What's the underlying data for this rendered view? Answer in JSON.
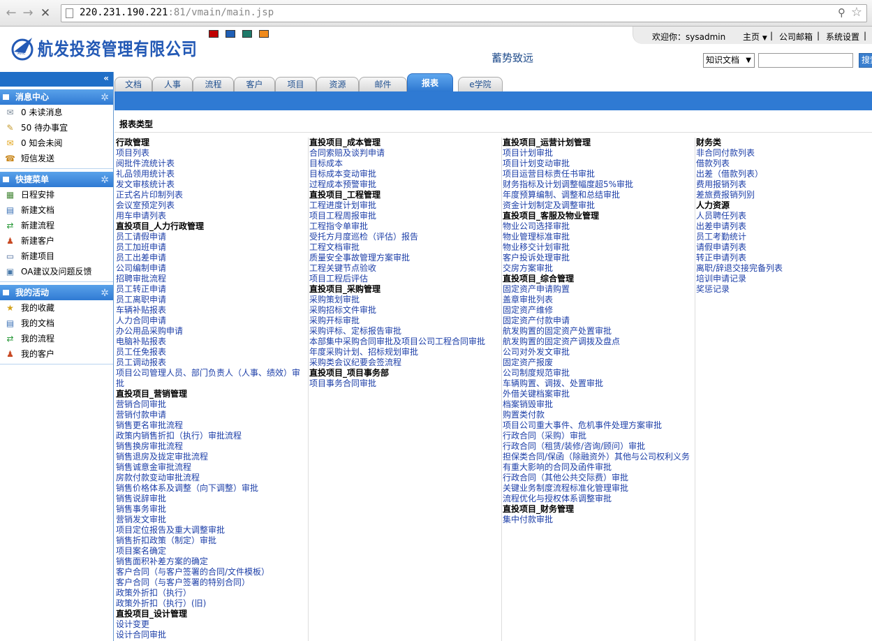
{
  "browser": {
    "url_host": "220.231.190.221",
    "url_rest": ":81/vmain/main.jsp"
  },
  "header": {
    "company_name": "航发投资管理有限公司",
    "slogan": "蓄势致远",
    "welcome": "欢迎你：sysadmin",
    "home": "主页",
    "mail": "公司邮箱",
    "settings": "系统设置",
    "search_select": "知识文档",
    "search_button": "搜索",
    "swatch_colors": [
      "#c00000",
      "#1f5fb5",
      "#1f7a6a",
      "#f08a1c"
    ]
  },
  "sidebar": {
    "collapse": "«",
    "panels": [
      {
        "title": "消息中心",
        "items": [
          "0 未读消息",
          "50 待办事宜",
          "0 知会未阅",
          "短信发送"
        ]
      },
      {
        "title": "快捷菜单",
        "items": [
          "日程安排",
          "新建文档",
          "新建流程",
          "新建客户",
          "新建项目",
          "OA建议及问题反馈"
        ]
      },
      {
        "title": "我的活动",
        "items": [
          "我的收藏",
          "我的文档",
          "我的流程",
          "我的客户"
        ]
      }
    ]
  },
  "tabs": [
    "文档",
    "人事",
    "流程",
    "客户",
    "项目",
    "资源",
    "邮件",
    "报表",
    "e学院"
  ],
  "active_tab": "报表",
  "section_title": "报表类型",
  "columns": [
    [
      {
        "t": "h",
        "v": "行政管理"
      },
      {
        "t": "l",
        "v": "项目列表"
      },
      {
        "t": "l",
        "v": "阅批件流统计表"
      },
      {
        "t": "l",
        "v": "礼品领用统计表"
      },
      {
        "t": "l",
        "v": "发文审核统计表"
      },
      {
        "t": "l",
        "v": "正式名片印制列表"
      },
      {
        "t": "l",
        "v": "会议室预定列表"
      },
      {
        "t": "l",
        "v": "用车申请列表"
      },
      {
        "t": "h",
        "v": "直投项目_人力行政管理"
      },
      {
        "t": "l",
        "v": "员工请假申请"
      },
      {
        "t": "l",
        "v": "员工加班申请"
      },
      {
        "t": "l",
        "v": "员工出差申请"
      },
      {
        "t": "l",
        "v": "公司编制申请"
      },
      {
        "t": "l",
        "v": "招聘审批流程"
      },
      {
        "t": "l",
        "v": "员工转正申请"
      },
      {
        "t": "l",
        "v": "员工离职申请"
      },
      {
        "t": "l",
        "v": "车辆补贴报表"
      },
      {
        "t": "l",
        "v": "人力合同申请"
      },
      {
        "t": "l",
        "v": "办公用品采购申请"
      },
      {
        "t": "l",
        "v": "电脑补贴报表"
      },
      {
        "t": "l",
        "v": "员工任免报表"
      },
      {
        "t": "l",
        "v": "员工调动报表"
      },
      {
        "t": "w",
        "v": "项目公司管理人员、部门负责人（人事、绩效）审批"
      },
      {
        "t": "h",
        "v": "直投项目_营销管理"
      },
      {
        "t": "l",
        "v": "营销合同审批"
      },
      {
        "t": "l",
        "v": "营销付款申请"
      },
      {
        "t": "l",
        "v": "销售更名审批流程"
      },
      {
        "t": "l",
        "v": "政策内销售折扣（执行）审批流程"
      },
      {
        "t": "l",
        "v": "销售换房审批流程"
      },
      {
        "t": "l",
        "v": "销售退房及拢定审批流程"
      },
      {
        "t": "l",
        "v": "销售诚意金审批流程"
      },
      {
        "t": "l",
        "v": "房款付款变动审批流程"
      },
      {
        "t": "l",
        "v": "销售价格体系及调整（向下调整）审批"
      },
      {
        "t": "l",
        "v": "销售说辞审批"
      },
      {
        "t": "l",
        "v": "销售事务审批"
      },
      {
        "t": "l",
        "v": "营销发文审批"
      },
      {
        "t": "l",
        "v": "项目定位报告及重大调整审批"
      },
      {
        "t": "l",
        "v": "销售折扣政策（制定）审批"
      },
      {
        "t": "l",
        "v": "项目案名确定"
      },
      {
        "t": "l",
        "v": "销售面积补差方案的确定"
      },
      {
        "t": "l",
        "v": "客户合同（与客户签署的合同/文件模板）"
      },
      {
        "t": "l",
        "v": "客户合同（与客户签署的特别合同）"
      },
      {
        "t": "l",
        "v": "政策外折扣（执行）"
      },
      {
        "t": "l",
        "v": "政策外折扣（执行）(旧)"
      },
      {
        "t": "h",
        "v": "直投项目_设计管理"
      },
      {
        "t": "l",
        "v": "设计变更"
      },
      {
        "t": "l",
        "v": "设计合同审批"
      }
    ],
    [
      {
        "t": "h",
        "v": "直投项目_成本管理"
      },
      {
        "t": "l",
        "v": "合同索赔及谈判申请"
      },
      {
        "t": "l",
        "v": "目标成本"
      },
      {
        "t": "l",
        "v": "目标成本变动审批"
      },
      {
        "t": "l",
        "v": "过程成本预警审批"
      },
      {
        "t": "h",
        "v": "直投项目_工程管理"
      },
      {
        "t": "l",
        "v": "工程进度计划审批"
      },
      {
        "t": "l",
        "v": "项目工程周报审批"
      },
      {
        "t": "l",
        "v": "工程指令单审批"
      },
      {
        "t": "l",
        "v": "受托方月度巡检（评估）报告"
      },
      {
        "t": "l",
        "v": "工程文档审批"
      },
      {
        "t": "l",
        "v": "质量安全事故管理方案审批"
      },
      {
        "t": "l",
        "v": "工程关键节点验收"
      },
      {
        "t": "l",
        "v": "项目工程后评估"
      },
      {
        "t": "h",
        "v": "直投项目_采购管理"
      },
      {
        "t": "l",
        "v": "采购策划审批"
      },
      {
        "t": "l",
        "v": "采购招标文件审批"
      },
      {
        "t": "l",
        "v": "采购开标审批"
      },
      {
        "t": "l",
        "v": "采购评标、定标报告审批"
      },
      {
        "t": "l",
        "v": "本部集中采购合同审批及项目公司工程合同审批"
      },
      {
        "t": "l",
        "v": "年度采购计划、招标规划审批"
      },
      {
        "t": "l",
        "v": "采购类会议纪要会签流程"
      },
      {
        "t": "h",
        "v": "直投项目_项目事务部"
      },
      {
        "t": "l",
        "v": "项目事务合同审批"
      }
    ],
    [
      {
        "t": "h",
        "v": "直投项目_运营计划管理"
      },
      {
        "t": "l",
        "v": "项目计划审批"
      },
      {
        "t": "l",
        "v": "项目计划变动审批"
      },
      {
        "t": "l",
        "v": "项目运营目标责任书审批"
      },
      {
        "t": "l",
        "v": "财务指标及计划调整幅度超5%审批"
      },
      {
        "t": "l",
        "v": "年度预算编制、调整和总结审批"
      },
      {
        "t": "l",
        "v": "资金计划制定及调整审批"
      },
      {
        "t": "h",
        "v": "直投项目_客服及物业管理"
      },
      {
        "t": "l",
        "v": "物业公司选择审批"
      },
      {
        "t": "l",
        "v": "物业管理标准审批"
      },
      {
        "t": "l",
        "v": "物业移交计划审批"
      },
      {
        "t": "l",
        "v": "客户投诉处理审批"
      },
      {
        "t": "l",
        "v": "交房方案审批"
      },
      {
        "t": "h",
        "v": "直投项目_综合管理"
      },
      {
        "t": "l",
        "v": "固定资产申请购置"
      },
      {
        "t": "l",
        "v": "盖章审批列表"
      },
      {
        "t": "l",
        "v": "固定资产维修"
      },
      {
        "t": "l",
        "v": "固定资产付款申请"
      },
      {
        "t": "l",
        "v": "航发购置的固定资产处置审批"
      },
      {
        "t": "l",
        "v": "航发购置的固定资产调拨及盘点"
      },
      {
        "t": "l",
        "v": "公司对外发文审批"
      },
      {
        "t": "l",
        "v": "固定资产报废"
      },
      {
        "t": "l",
        "v": "公司制度规范审批"
      },
      {
        "t": "l",
        "v": "车辆购置、调拨、处置审批"
      },
      {
        "t": "l",
        "v": "外借关键档案审批"
      },
      {
        "t": "l",
        "v": "档案销毁审批"
      },
      {
        "t": "l",
        "v": "购置类付款"
      },
      {
        "t": "l",
        "v": "项目公司重大事件、危机事件处理方案审批"
      },
      {
        "t": "l",
        "v": "行政合同（采购）审批"
      },
      {
        "t": "l",
        "v": "行政合同（租赁/装修/咨询/顾问）审批"
      },
      {
        "t": "l",
        "v": "担保类合同/保函（除融资外）其他与公司权利义务"
      },
      {
        "t": "l",
        "v": "有重大影响的合同及函件审批"
      },
      {
        "t": "l",
        "v": "行政合同（其他公共交际费）审批"
      },
      {
        "t": "l",
        "v": "关键业务制度流程标准化管理审批"
      },
      {
        "t": "l",
        "v": "流程优化与授权体系调整审批"
      },
      {
        "t": "h",
        "v": "直投项目_财务管理"
      },
      {
        "t": "l",
        "v": "集中付款审批"
      }
    ],
    [
      {
        "t": "h",
        "v": "财务类"
      },
      {
        "t": "l",
        "v": "非合同付款列表"
      },
      {
        "t": "l",
        "v": "借款列表"
      },
      {
        "t": "l",
        "v": "出差（借款列表）"
      },
      {
        "t": "l",
        "v": "费用报销列表"
      },
      {
        "t": "l",
        "v": "差旅费报销列别"
      },
      {
        "t": "h",
        "v": "人力资源"
      },
      {
        "t": "l",
        "v": "人员聘任列表"
      },
      {
        "t": "l",
        "v": "出差申请列表"
      },
      {
        "t": "l",
        "v": "员工考勤统计"
      },
      {
        "t": "l",
        "v": "请假申请列表"
      },
      {
        "t": "l",
        "v": "转正申请列表"
      },
      {
        "t": "l",
        "v": "离职/辞退交接完备列表"
      },
      {
        "t": "l",
        "v": "培训申请记录"
      },
      {
        "t": "l",
        "v": "奖惩记录"
      }
    ]
  ]
}
